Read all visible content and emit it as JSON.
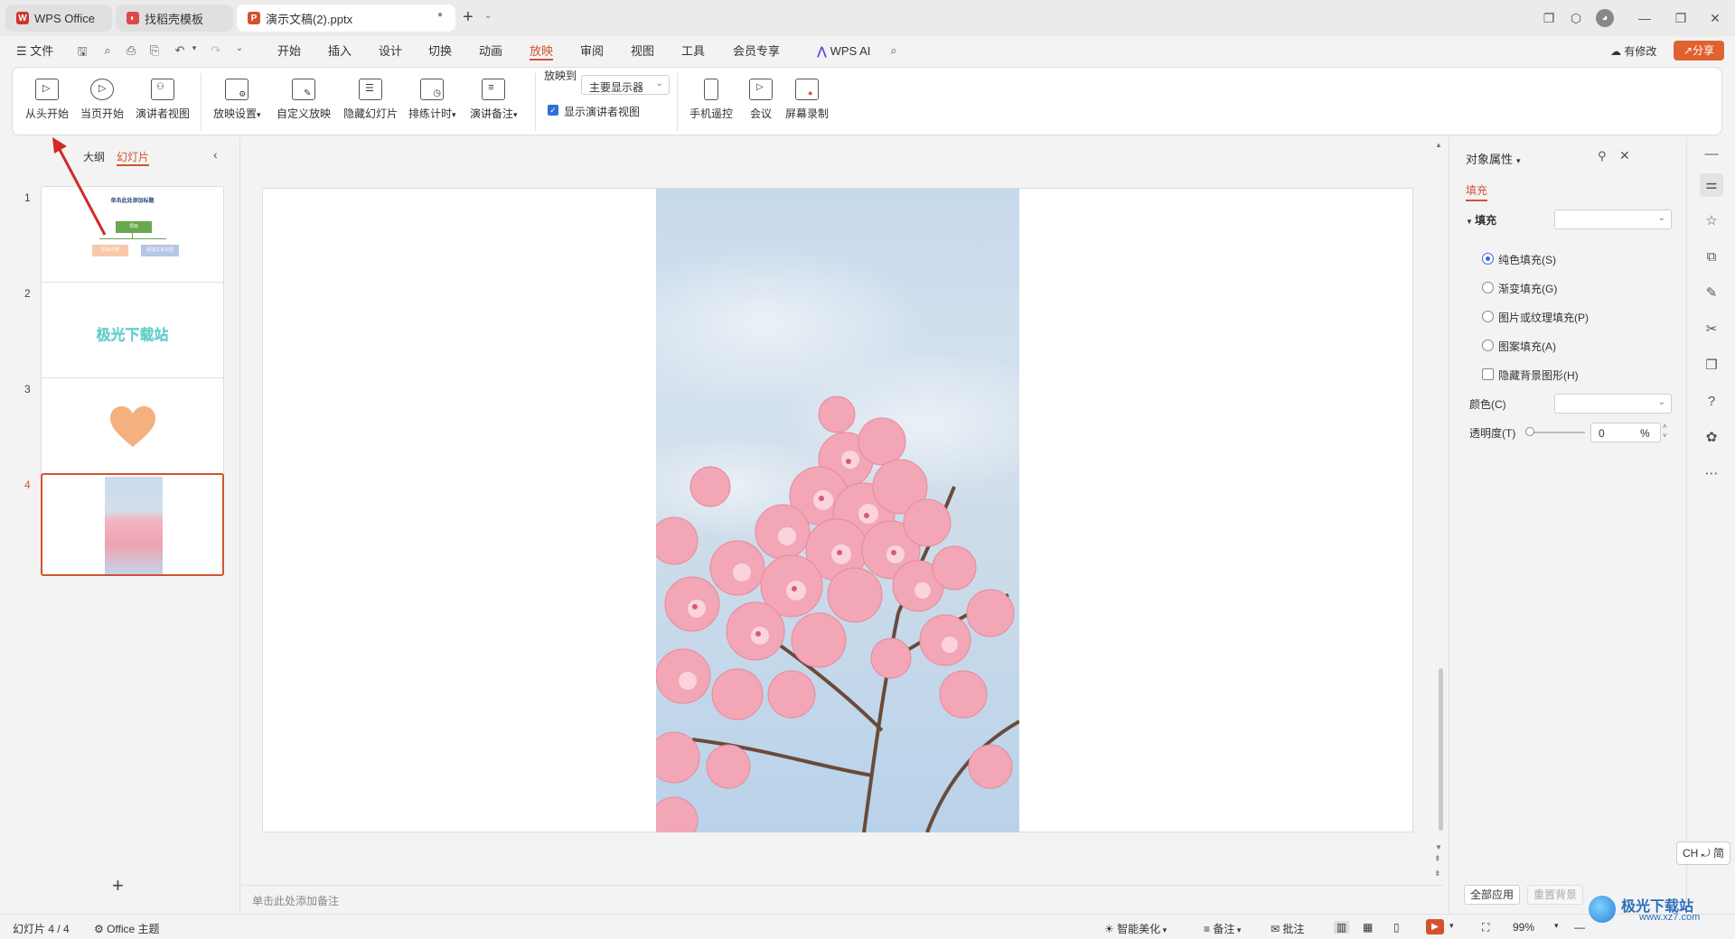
{
  "tabs": [
    {
      "label": "WPS Office",
      "icon": "wps-logo-icon"
    },
    {
      "label": "找稻壳模板",
      "icon": "docer-icon"
    },
    {
      "label": "演示文稿(2).pptx",
      "icon": "ppt-icon",
      "status": "●"
    }
  ],
  "new_tab": "+",
  "menu": {
    "file": "文件",
    "items": [
      "开始",
      "插入",
      "设计",
      "切换",
      "动画",
      "放映",
      "审阅",
      "视图",
      "工具",
      "会员专享"
    ],
    "active": "放映",
    "ai": "WPS AI",
    "modify": "有修改",
    "share": "分享"
  },
  "ribbon": {
    "buttons1": [
      {
        "label": "从头开始",
        "icon": "play-from-start-icon"
      },
      {
        "label": "当页开始",
        "icon": "play-current-icon"
      },
      {
        "label": "演讲者视图",
        "icon": "presenter-view-icon"
      }
    ],
    "buttons2": [
      {
        "label": "放映设置",
        "icon": "slideshow-settings-icon",
        "dropdown": true
      },
      {
        "label": "自定义放映",
        "icon": "custom-show-icon",
        "dropdown": false
      },
      {
        "label": "隐藏幻灯片",
        "icon": "hide-slide-icon",
        "dropdown": false
      },
      {
        "label": "排练计时",
        "icon": "rehearse-timing-icon",
        "dropdown": true
      },
      {
        "label": "演讲备注",
        "icon": "speaker-notes-icon",
        "dropdown": true
      }
    ],
    "play_to_label": "放映到",
    "play_to_value": "主要显示器",
    "presenter_checkbox": "显示演讲者视图",
    "buttons3": [
      {
        "label": "手机遥控",
        "icon": "phone-remote-icon"
      },
      {
        "label": "会议",
        "icon": "meeting-icon"
      },
      {
        "label": "屏幕录制",
        "icon": "screen-record-icon"
      }
    ]
  },
  "left_panel": {
    "tab_outline": "大纲",
    "tab_slides": "幻灯片",
    "slides": [
      {
        "num": "1",
        "title": "单击此处添加标题",
        "box_main": "项目",
        "box_a": "项目内容",
        "box_b": "添加文本内容"
      },
      {
        "num": "2",
        "text": "极光下载站"
      },
      {
        "num": "3"
      },
      {
        "num": "4"
      }
    ],
    "add": "+"
  },
  "notes_placeholder": "单击此处添加备注",
  "right_panel": {
    "title": "对象属性",
    "tab": "填充",
    "section": "填充",
    "options": [
      {
        "label": "纯色填充(S)",
        "checked": true
      },
      {
        "label": "渐变填充(G)",
        "checked": false
      },
      {
        "label": "图片或纹理填充(P)",
        "checked": false
      },
      {
        "label": "图案填充(A)",
        "checked": false
      }
    ],
    "hide_bg": "隐藏背景图形(H)",
    "color_label": "颜色(C)",
    "transparency_label": "透明度(T)",
    "transparency_value": "0",
    "percent": "%",
    "apply_all": "全部应用",
    "reset_bg": "重置背景"
  },
  "ime": "CH ⤾ 简",
  "status": {
    "slide_count": "幻灯片 4 / 4",
    "theme": "Office 主题",
    "beautify": "智能美化",
    "notes": "备注",
    "comments": "批注",
    "zoom": "99%"
  },
  "watermark": {
    "text": "极光下载站",
    "url": "www.xz7.com"
  }
}
